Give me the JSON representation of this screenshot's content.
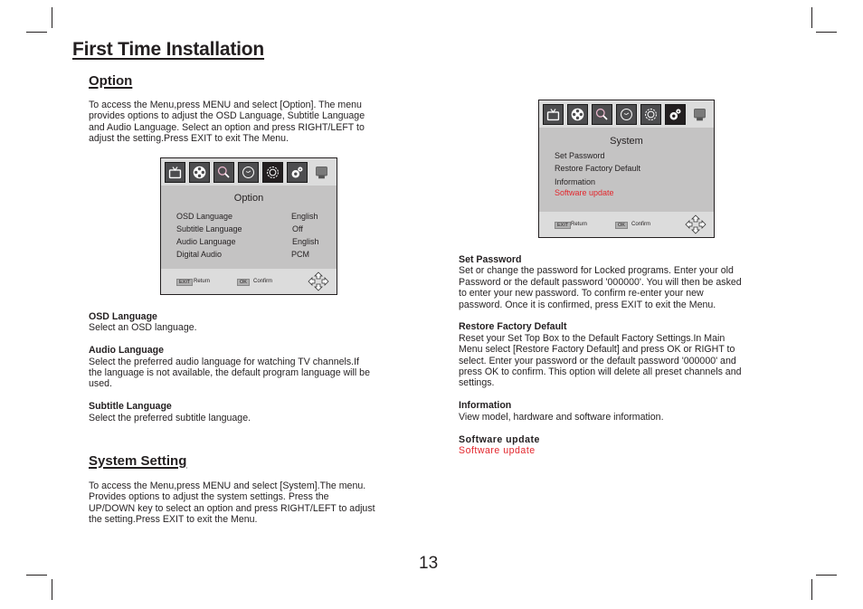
{
  "page": {
    "title": "First Time Installation",
    "page_number": "13"
  },
  "option_section": {
    "heading": "Option",
    "intro": "To access the Menu,press MENU and select [Option]. The menu provides options to adjust the OSD Language, Subtitle Language and Audio Language. Select an option and press RIGHT/LEFT to adjust the setting.Press EXIT to exit The Menu.",
    "intro_lines": [
      "To access the Menu,press MENU and select [Option]. The menu",
      "provides options to adjust the OSD Language, Subtitle Language",
      "and Audio Language. Select an option and press RIGHT/LEFT to",
      "adjust the setting.Press EXIT to exit The Menu."
    ],
    "screen": {
      "title": "Option",
      "active_icon": "gear-icon",
      "rows": [
        {
          "label": "OSD Language",
          "value": "English"
        },
        {
          "label": "Subtitle Language",
          "value": "Off"
        },
        {
          "label": "Audio Language",
          "value": "English"
        },
        {
          "label": "Digital Audio",
          "value": "PCM"
        }
      ],
      "footer": {
        "exit_key": "EXIT",
        "exit_label": "Return",
        "ok_key": "OK",
        "ok_label": "Confirm"
      }
    },
    "descriptions": [
      {
        "title": "OSD Language",
        "lines": [
          "Select an OSD language."
        ]
      },
      {
        "title": "Audio Language",
        "lines": [
          "Select the preferred audio language for watching TV channels.If",
          "the language is not available, the default program language will be",
          "used."
        ]
      },
      {
        "title": "Subtitle Language",
        "lines": [
          "Select the preferred subtitle language."
        ]
      }
    ]
  },
  "system_section": {
    "heading": "System Setting",
    "intro_lines": [
      "To access the Menu,press MENU and select [System].The menu.",
      "Provides options to adjust the system settings. Press the",
      "UP/DOWN key to select an option and press RIGHT/LEFT to adjust",
      "the setting.Press EXIT to exit the Menu."
    ],
    "screen": {
      "title": "System",
      "active_icon": "system-gears-icon",
      "rows": [
        {
          "label": "Set Password",
          "highlighted": false
        },
        {
          "label": "Restore Factory Default",
          "highlighted": false
        },
        {
          "label": "Information",
          "highlighted": false
        },
        {
          "label": "Software update",
          "highlighted": true
        }
      ],
      "footer": {
        "exit_key": "EXIT",
        "exit_label": "Return",
        "ok_key": "OK",
        "ok_label": "Confirm"
      }
    },
    "descriptions": [
      {
        "title": "Set Password",
        "lines": [
          "Set or change the password for Locked programs.  Enter your old",
          "Password or the default password '000000'. You will then be asked",
          "to enter your new password. To confirm re-enter your new",
          "password. Once it is confirmed, press EXIT to exit the Menu."
        ]
      },
      {
        "title": "Restore Factory Default",
        "lines": [
          "Reset your Set Top Box to the Default Factory Settings.In Main",
          "Menu select [Restore Factory Default] and press OK or RIGHT to",
          "select. Enter your password or the default password '000000' and",
          "press OK to confirm. This option will delete all preset channels and",
          "settings."
        ]
      },
      {
        "title": "Information",
        "lines": [
          "View model, hardware and software information."
        ]
      },
      {
        "title": "Software update",
        "lines": [
          "Software update"
        ]
      }
    ]
  },
  "colors": {
    "highlight_red": "#e3272d",
    "text": "#231f20",
    "osd_background": "#c4c3c3"
  },
  "menu_icons": [
    "tv-icon",
    "film-reel-icon",
    "search-icon",
    "clock-icon",
    "gear-icon",
    "system-gears-icon",
    "usb-icon"
  ]
}
